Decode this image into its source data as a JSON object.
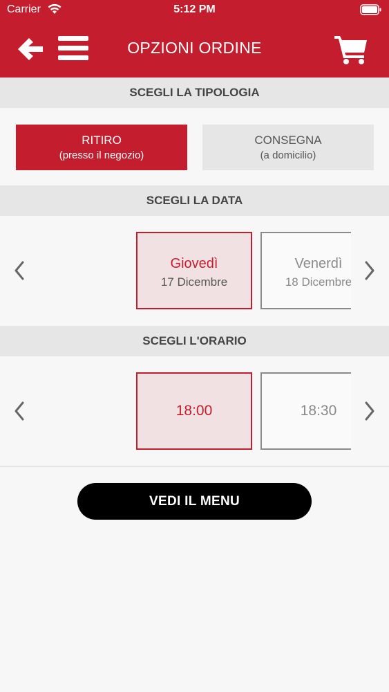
{
  "status_bar": {
    "carrier": "Carrier",
    "time": "5:12 PM"
  },
  "nav": {
    "title": "OPZIONI ORDINE",
    "back_icon": "back-arrow-icon",
    "menu_icon": "hamburger-menu-icon",
    "cart_icon": "shopping-cart-icon"
  },
  "type_section": {
    "header": "SCEGLI LA TIPOLOGIA",
    "options": [
      {
        "label": "RITIRO",
        "sublabel": "(presso il negozio)",
        "selected": true
      },
      {
        "label": "CONSEGNA",
        "sublabel": "(a domicilio)",
        "selected": false
      }
    ]
  },
  "date_section": {
    "header": "SCEGLI LA DATA",
    "dates": [
      {
        "day": "Giovedì",
        "date": "17 Dicembre",
        "selected": true
      },
      {
        "day": "Venerdì",
        "date": "18 Dicembre",
        "selected": false
      }
    ]
  },
  "time_section": {
    "header": "SCEGLI L'ORARIO",
    "times": [
      {
        "time": "18:00",
        "selected": true
      },
      {
        "time": "18:30",
        "selected": false
      }
    ]
  },
  "cta": {
    "label": "VEDI IL MENU"
  },
  "colors": {
    "brand_red": "#c41e2e",
    "selected_bg": "#f2e1e3",
    "section_bg": "#e6e6e6",
    "button_black": "#000000"
  }
}
